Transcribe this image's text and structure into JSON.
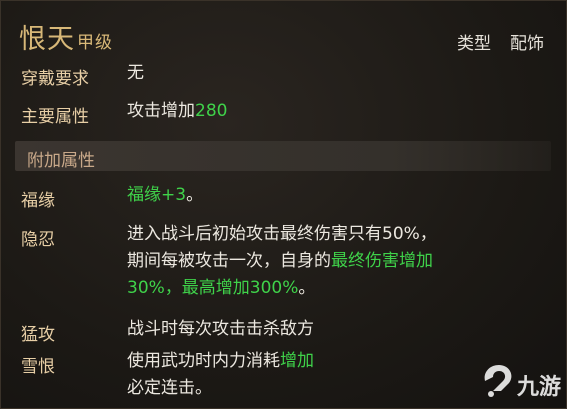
{
  "item": {
    "name": "恨天",
    "grade": "甲级",
    "type_label": "类型",
    "type_value": "配饰"
  },
  "requirements": {
    "label": "穿戴要求",
    "value": "无"
  },
  "main_attr": {
    "label": "主要属性",
    "text": "攻击增加",
    "value": "280"
  },
  "extra_section": {
    "title": "附加属性"
  },
  "extras": [
    {
      "name": "福缘",
      "lines": [
        [
          {
            "t": "福缘+3",
            "g": true
          },
          {
            "t": "。",
            "g": false
          }
        ]
      ]
    },
    {
      "name": "隐忍",
      "lines": [
        [
          {
            "t": "进入战斗后初始攻击最终伤害只有50%，",
            "g": false
          }
        ],
        [
          {
            "t": "期间每被攻击一次，自身的",
            "g": false
          },
          {
            "t": "最终伤害增加",
            "g": true
          }
        ],
        [
          {
            "t": "30%，最高增加300%",
            "g": true
          },
          {
            "t": "。",
            "g": false
          }
        ]
      ]
    },
    {
      "name": "猛攻",
      "lines": [
        [
          {
            "t": "战斗时每次攻击击杀敌方",
            "g": false
          }
        ]
      ]
    },
    {
      "name": "雪恨",
      "lines": [
        [
          {
            "t": "使用武功时内力消耗",
            "g": false
          },
          {
            "t": "增加",
            "g": true
          }
        ],
        [
          {
            "t": "必定连击。",
            "g": false
          }
        ]
      ]
    }
  ],
  "watermark": {
    "text": "九游",
    "icon": "jiuyou-logo-icon"
  },
  "colors": {
    "title": "#d8b878",
    "label": "#e8cfa6",
    "text": "#ece8e0",
    "highlight": "#3fd24a",
    "background": "#1c1915"
  }
}
